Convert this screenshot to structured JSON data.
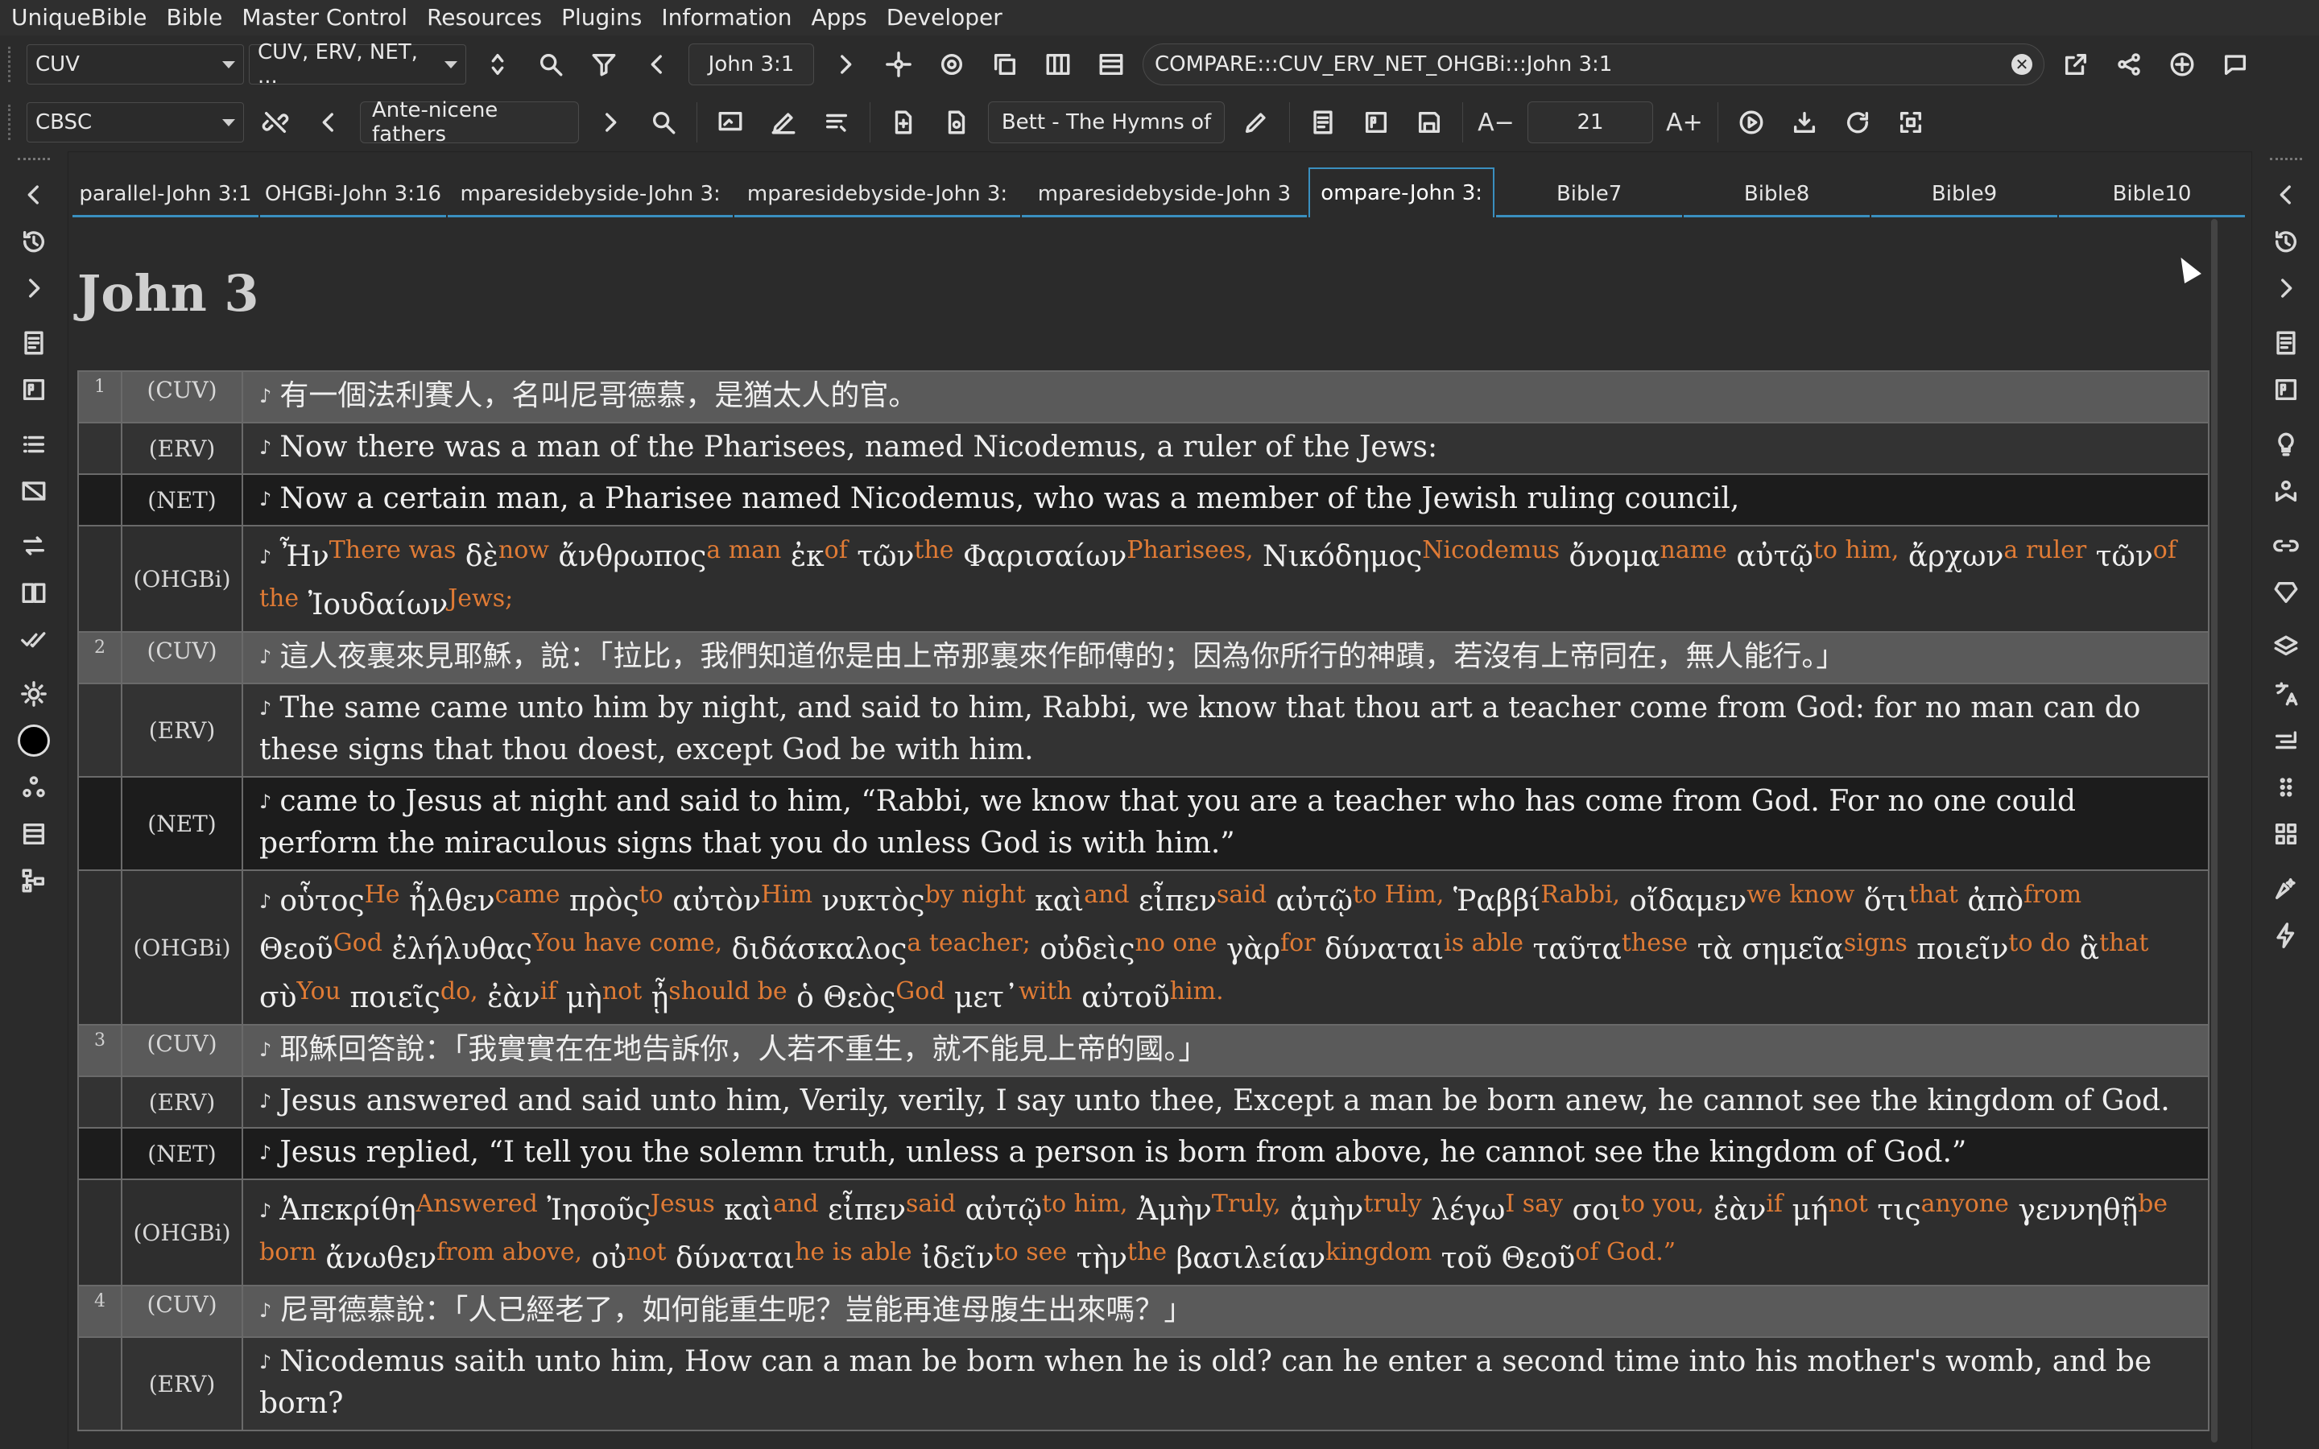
{
  "menu": [
    "UniqueBible",
    "Bible",
    "Master Control",
    "Resources",
    "Plugins",
    "Information",
    "Apps",
    "Developer"
  ],
  "toolbar1": {
    "bible_combo": "CUV",
    "compare_combo": "CUV, ERV, NET, ...",
    "reference": "John 3:1",
    "command": "COMPARE:::CUV_ERV_NET_OHGBi:::John 3:1"
  },
  "toolbar2": {
    "commentary_combo": "CBSC",
    "book_nav": "Ante-nicene fathers",
    "hymns": "Bett - The Hymns of",
    "font_size": "21"
  },
  "tabs": [
    {
      "label": "parallel-John 3:1"
    },
    {
      "label": "OHGBi-John 3:16"
    },
    {
      "label": "mparesidebyside-John 3:"
    },
    {
      "label": "mparesidebyside-John 3:"
    },
    {
      "label": "mparesidebyside-John 3"
    },
    {
      "label": "ompare-John 3:"
    },
    {
      "label": "Bible7"
    },
    {
      "label": "Bible8"
    },
    {
      "label": "Bible9"
    },
    {
      "label": "Bible10"
    }
  ],
  "chapter_title": "John 3",
  "verses": {
    "v1": {
      "num": "1",
      "cuv": "有一個法利賽人，名叫尼哥德慕，是猶太人的官。",
      "erv": "Now there was a man of the Pharisees, named Nicodemus, a ruler of the Jews:",
      "net": "Now a certain man, a Pharisee named Nicodemus, who was a member of the Jewish ruling council,",
      "gk": [
        [
          "Ἦν",
          "There was"
        ],
        [
          "δὲ",
          "now"
        ],
        [
          "ἄνθρωπος",
          "a man"
        ],
        [
          "ἐκ",
          "of"
        ],
        [
          "τῶν",
          "the"
        ],
        [
          "Φαρισαίων",
          "Pharisees,"
        ],
        [
          "Νικόδημος",
          "Nicodemus"
        ],
        [
          "ὄνομα",
          "name"
        ],
        [
          "αὐτῷ",
          "to him,"
        ],
        [
          "ἄρχων",
          "a ruler"
        ],
        [
          "τῶν",
          "of the"
        ],
        [
          "Ἰουδαίων",
          "Jews;"
        ]
      ]
    },
    "v2": {
      "num": "2",
      "cuv": "這人夜裏來見耶穌，說：「拉比，我們知道你是由上帝那裏來作師傅的；因為你所行的神蹟，若沒有上帝同在，無人能行。」",
      "erv": "The same came unto him by night, and said to him, Rabbi, we know that thou art a teacher come from God: for no man can do these signs that thou doest, except God be with him.",
      "net": "came to Jesus at night and said to him, “Rabbi, we know that you are a teacher who has come from God. For no one could perform the miraculous signs that you do unless God is with him.”",
      "gk": [
        [
          "οὗτος",
          "He"
        ],
        [
          "ἦλθεν",
          "came"
        ],
        [
          "πρὸς",
          "to"
        ],
        [
          "αὐτὸν",
          "Him"
        ],
        [
          "νυκτὸς",
          "by night"
        ],
        [
          "καὶ",
          "and"
        ],
        [
          "εἶπεν",
          "said"
        ],
        [
          "αὐτῷ",
          "to Him,"
        ],
        [
          "Ῥαββί",
          "Rabbi,"
        ],
        [
          "οἴδαμεν",
          "we know"
        ],
        [
          "ὅτι",
          "that"
        ],
        [
          "ἀπὸ",
          "from"
        ],
        [
          "Θεοῦ",
          "God"
        ],
        [
          "ἐλήλυθας",
          "You have come,"
        ],
        [
          "διδάσκαλος",
          "a teacher;"
        ],
        [
          "οὐδεὶς",
          "no one"
        ],
        [
          "γὰρ",
          "for"
        ],
        [
          "δύναται",
          "is able"
        ],
        [
          "ταῦτα",
          "these"
        ],
        [
          "τὰ",
          ""
        ],
        [
          "σημεῖα",
          "signs"
        ],
        [
          "ποιεῖν",
          "to do"
        ],
        [
          "ἃ",
          "that"
        ],
        [
          "σὺ",
          "You"
        ],
        [
          "ποιεῖς",
          "do,"
        ],
        [
          "ἐὰν",
          "if"
        ],
        [
          "μὴ",
          "not"
        ],
        [
          "ᾖ",
          "should be"
        ],
        [
          "ὁ",
          ""
        ],
        [
          "Θεὸς",
          "God"
        ],
        [
          "μετ᾽",
          "with"
        ],
        [
          "αὐτοῦ",
          "him."
        ]
      ]
    },
    "v3": {
      "num": "3",
      "cuv": "耶穌回答說：「我實實在在地告訴你，人若不重生，就不能見上帝的國。」",
      "erv": "Jesus answered and said unto him, Verily, verily, I say unto thee, Except a man be born anew, he cannot see the kingdom of God.",
      "net": "Jesus replied, “I tell you the solemn truth, unless a person is born from above, he cannot see the kingdom of God.”",
      "gk": [
        [
          "Ἀπεκρίθη",
          "Answered"
        ],
        [
          "Ἰησοῦς",
          "Jesus"
        ],
        [
          "καὶ",
          "and"
        ],
        [
          "εἶπεν",
          "said"
        ],
        [
          "αὐτῷ",
          "to him,"
        ],
        [
          "Ἀμὴν",
          "Truly,"
        ],
        [
          "ἀμὴν",
          "truly"
        ],
        [
          "λέγω",
          "I say"
        ],
        [
          "σοι",
          "to you,"
        ],
        [
          "ἐὰν",
          "if"
        ],
        [
          "μή",
          "not"
        ],
        [
          "τις",
          "anyone"
        ],
        [
          "γεννηθῇ",
          "be born"
        ],
        [
          "ἄνωθεν",
          "from above,"
        ],
        [
          "οὐ",
          "not"
        ],
        [
          "δύναται",
          "he is able"
        ],
        [
          "ἰδεῖν",
          "to see"
        ],
        [
          "τὴν",
          "the"
        ],
        [
          "βασιλείαν",
          "kingdom"
        ],
        [
          "τοῦ",
          ""
        ],
        [
          "Θεοῦ",
          "of God.”"
        ]
      ]
    },
    "v4": {
      "num": "4",
      "cuv": "尼哥德慕說：「人已經老了，如何能重生呢？豈能再進母腹生出來嗎？」",
      "erv": "Nicodemus saith unto him, How can a man be born when he is old? can he enter a second time into his mother's womb, and be born?"
    }
  },
  "version_tags": {
    "cuv": "(CUV)",
    "erv": "(ERV)",
    "net": "(NET)",
    "gk": "(OHGBi)"
  },
  "note_glyph": "♪"
}
